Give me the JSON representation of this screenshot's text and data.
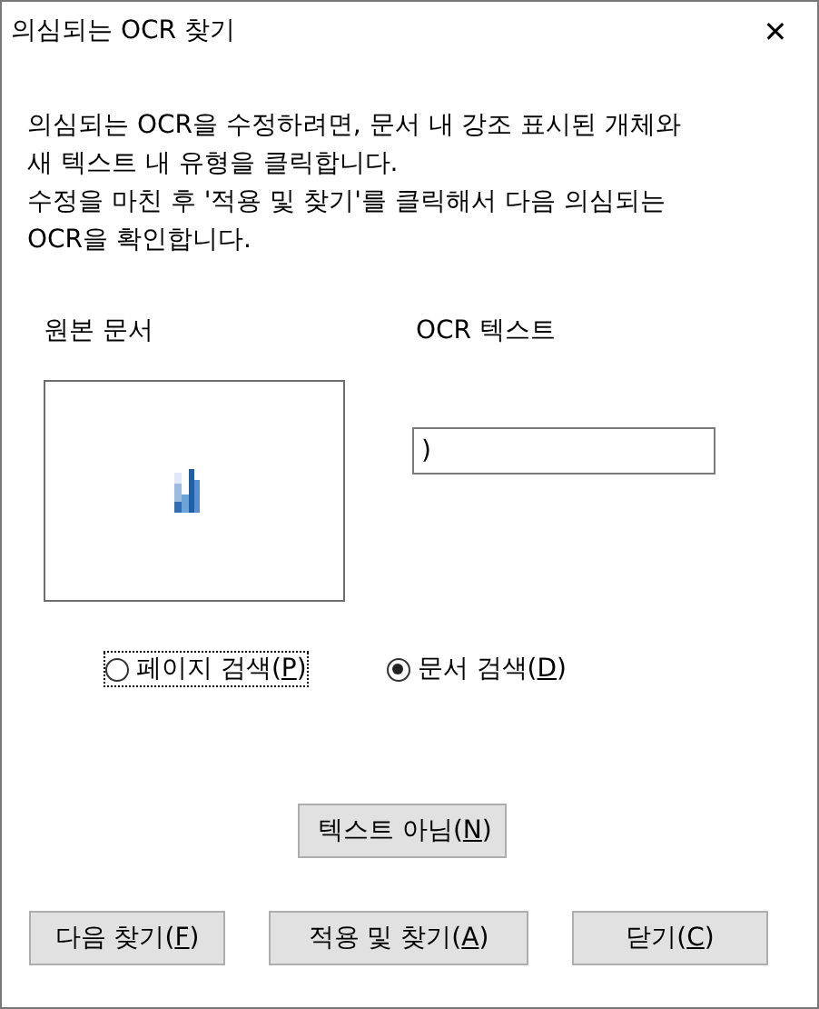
{
  "window": {
    "title": "의심되는 OCR 찾기",
    "close": "✕"
  },
  "instructions": [
    "의심되는 OCR을 수정하려면, 문서 내 강조 표시된 개체와",
    "새 텍스트 내 유형을 클릭합니다.",
    "수정을 마친 후 '적용 및 찾기'를 클릭해서 다음 의심되는",
    "OCR을 확인합니다."
  ],
  "source": {
    "label": "원본 문서"
  },
  "ocr": {
    "label": "OCR 텍스트",
    "value": ")"
  },
  "scope": [
    {
      "text": "페이지 검색(",
      "accel": "P",
      "text_end": ")",
      "selected": false,
      "focused": true
    },
    {
      "text": "문서 검색(",
      "accel": "D",
      "text_end": ")",
      "selected": true,
      "focused": false
    }
  ],
  "not_text_button": {
    "text": "텍스트 아님(",
    "accel": "N",
    "text_end": ")"
  },
  "buttons": [
    {
      "text": "다음 찾기(",
      "accel": "F",
      "text_end": ")"
    },
    {
      "text": "적용 및 찾기(",
      "accel": "A",
      "text_end": ")"
    },
    {
      "text": "닫기(",
      "accel": "C",
      "text_end": ")"
    }
  ]
}
